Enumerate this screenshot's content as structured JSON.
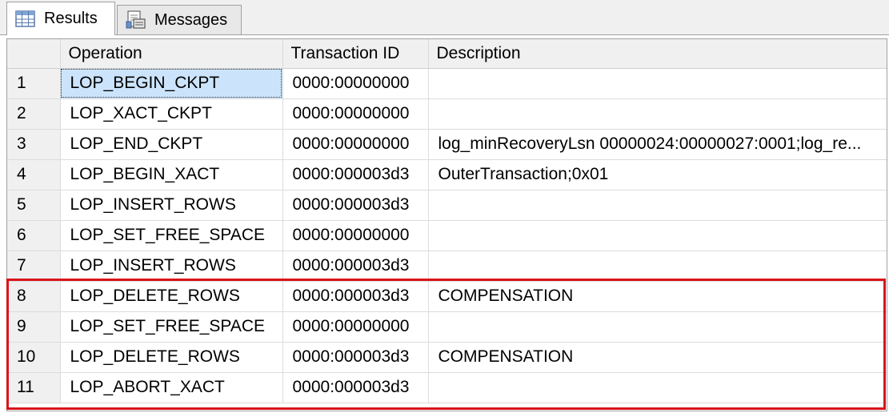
{
  "tabs": {
    "results_label": "Results",
    "messages_label": "Messages"
  },
  "grid": {
    "columns": [
      "",
      "Operation",
      "Transaction ID",
      "Description"
    ],
    "rows": [
      {
        "num": "1",
        "operation": "LOP_BEGIN_CKPT",
        "transaction_id": "0000:00000000",
        "description": ""
      },
      {
        "num": "2",
        "operation": "LOP_XACT_CKPT",
        "transaction_id": "0000:00000000",
        "description": ""
      },
      {
        "num": "3",
        "operation": "LOP_END_CKPT",
        "transaction_id": "0000:00000000",
        "description": "log_minRecoveryLsn 00000024:00000027:0001;log_re..."
      },
      {
        "num": "4",
        "operation": "LOP_BEGIN_XACT",
        "transaction_id": "0000:000003d3",
        "description": "OuterTransaction;0x01"
      },
      {
        "num": "5",
        "operation": "LOP_INSERT_ROWS",
        "transaction_id": "0000:000003d3",
        "description": ""
      },
      {
        "num": "6",
        "operation": "LOP_SET_FREE_SPACE",
        "transaction_id": "0000:00000000",
        "description": ""
      },
      {
        "num": "7",
        "operation": "LOP_INSERT_ROWS",
        "transaction_id": "0000:000003d3",
        "description": ""
      },
      {
        "num": "8",
        "operation": "LOP_DELETE_ROWS",
        "transaction_id": "0000:000003d3",
        "description": "COMPENSATION"
      },
      {
        "num": "9",
        "operation": "LOP_SET_FREE_SPACE",
        "transaction_id": "0000:00000000",
        "description": ""
      },
      {
        "num": "10",
        "operation": "LOP_DELETE_ROWS",
        "transaction_id": "0000:000003d3",
        "description": "COMPENSATION"
      },
      {
        "num": "11",
        "operation": "LOP_ABORT_XACT",
        "transaction_id": "0000:000003d3",
        "description": ""
      }
    ],
    "selected_row": 1,
    "selected_column": "operation"
  },
  "icons": {
    "results": "grid-table-icon",
    "messages": "messages-document-icon"
  },
  "colors": {
    "highlight": "#d9141b",
    "selection": "#cce4fb"
  }
}
